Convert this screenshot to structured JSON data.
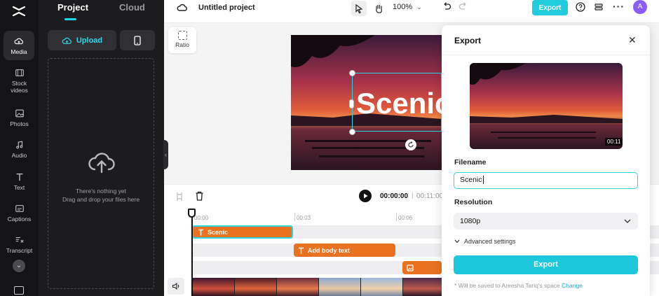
{
  "rail": {
    "items": [
      {
        "label": "Media",
        "icon": "media-cloud-icon"
      },
      {
        "label": "Stock\nvideos",
        "icon": "film-icon"
      },
      {
        "label": "Photos",
        "icon": "image-icon"
      },
      {
        "label": "Audio",
        "icon": "music-note-icon"
      },
      {
        "label": "Text",
        "icon": "text-t-icon"
      },
      {
        "label": "Captions",
        "icon": "captions-icon"
      },
      {
        "label": "Transcript",
        "icon": "transcript-icon"
      }
    ]
  },
  "panel": {
    "tabs": [
      "Project",
      "Cloud"
    ],
    "upload_label": "Upload",
    "empty_line1": "There's nothing yet",
    "empty_line2": "Drag and drop your files here"
  },
  "topbar": {
    "project_title": "Untitled project",
    "zoom": "100%",
    "export_label": "Export",
    "avatar_initial": "A"
  },
  "canvas": {
    "ratio_label": "Ratio",
    "overlay_text": "Scenic"
  },
  "timeline": {
    "current_time": "00:00:00",
    "separator": "|",
    "total_time": "00:11:00",
    "ruler": [
      "00:00",
      "00:03",
      "00:06"
    ],
    "clips": [
      {
        "label": "Scenic",
        "icon": "text-t-icon"
      },
      {
        "label": "Add body text",
        "icon": "text-t-icon"
      },
      {
        "label": "",
        "icon": "image-icon"
      }
    ]
  },
  "export_dialog": {
    "title": "Export",
    "duration": "00:11",
    "filename_label": "Filename",
    "filename_value": "Scenic",
    "resolution_label": "Resolution",
    "resolution_value": "1080p",
    "advanced_label": "Advanced settings",
    "export_button": "Export",
    "note_prefix": "* Will be saved to Areesha Tariq's space",
    "note_link": "Change"
  },
  "colors": {
    "accent": "#20ccdd",
    "clip_orange": "#e8721f",
    "rail_bg": "#141416",
    "panel_bg": "#1c1c1f"
  }
}
